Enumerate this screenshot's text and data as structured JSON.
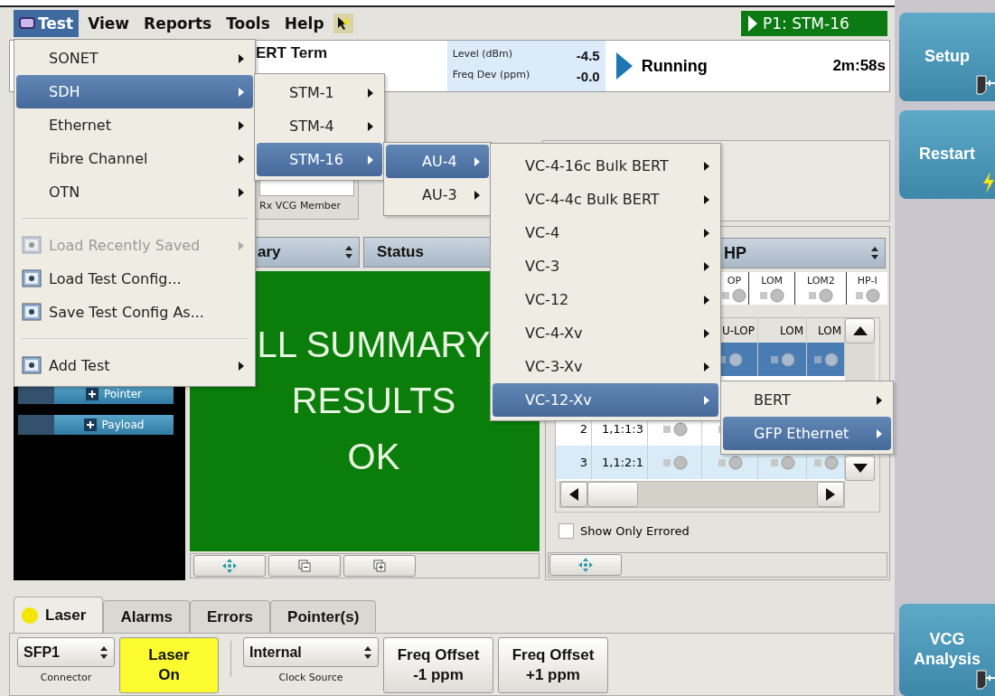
{
  "menubar": {
    "items": [
      {
        "label": "Test",
        "selected": true
      },
      {
        "label": "View",
        "selected": false
      },
      {
        "label": "Reports",
        "selected": false
      },
      {
        "label": "Tools",
        "selected": false
      },
      {
        "label": "Help",
        "selected": false
      }
    ],
    "port": "P1: STM-16"
  },
  "header": {
    "title": "ERT Term",
    "level_label": "Level (dBm)",
    "level_value": "-4.5",
    "freq_label": "Freq Dev (ppm)",
    "freq_value": "-0.0",
    "status": "Running",
    "elapsed": "2m:58s"
  },
  "vcg": {
    "label": "Rx VCG Member"
  },
  "tree": {
    "items": [
      {
        "label": "Pointer"
      },
      {
        "label": "Payload"
      }
    ]
  },
  "summary": {
    "columns": [
      {
        "label": "ary"
      },
      {
        "label": "Status"
      }
    ],
    "lines": [
      "LL SUMMARY",
      "RESULTS",
      "OK"
    ]
  },
  "alarms": {
    "layer": "HP",
    "indicators": [
      "OP",
      "LOM",
      "LOM2",
      "HP-I"
    ],
    "columns": [
      "U-LOP",
      "LOM",
      "LOM"
    ],
    "rows": [
      {
        "selected": true
      },
      {
        "index": "2",
        "channel": "1,1:1:3",
        "selected": false
      },
      {
        "index": "3",
        "channel": "1,1:2:1",
        "selected": false
      }
    ],
    "show_only_errored": {
      "label": "Show Only Errored",
      "checked": false
    }
  },
  "tabs": [
    {
      "label": "Laser",
      "selected": true,
      "color": "#f5e600"
    },
    {
      "label": "Alarms",
      "selected": false
    },
    {
      "label": "Errors",
      "selected": false
    },
    {
      "label": "Pointer(s)",
      "selected": false
    }
  ],
  "toolbar": {
    "connector": {
      "value": "SFP1",
      "label": "Connector"
    },
    "laser": {
      "label": "Laser On",
      "on": true
    },
    "clock": {
      "value": "Internal",
      "label": "Clock Source"
    },
    "buttons": [
      {
        "label": "Freq Offset -1 ppm"
      },
      {
        "label": "Freq Offset +1 ppm"
      }
    ]
  },
  "sidebar": {
    "top": [
      {
        "label": "Setup",
        "kind": "plug"
      },
      {
        "label": "Restart",
        "kind": "bolt"
      }
    ],
    "bottom": [
      {
        "label": "VCG Analysis",
        "kind": "plug"
      }
    ]
  },
  "menus": [
    {
      "items": [
        {
          "kind": "submenu",
          "label": "SONET",
          "selected": false,
          "disabled": false,
          "icon": false
        },
        {
          "kind": "submenu",
          "label": "SDH",
          "selected": true,
          "disabled": false,
          "icon": false
        },
        {
          "kind": "submenu",
          "label": "Ethernet",
          "selected": false,
          "disabled": false,
          "icon": false
        },
        {
          "kind": "submenu",
          "label": "Fibre Channel",
          "selected": false,
          "disabled": false,
          "icon": false
        },
        {
          "kind": "submenu",
          "label": "OTN",
          "selected": false,
          "disabled": false,
          "icon": false
        },
        {
          "kind": "separator"
        },
        {
          "kind": "submenu",
          "label": "Load Recently Saved",
          "selected": false,
          "disabled": true,
          "icon": true
        },
        {
          "kind": "action",
          "label": "Load Test Config...",
          "selected": false,
          "disabled": false,
          "icon": true
        },
        {
          "kind": "action",
          "label": "Save Test Config As...",
          "selected": false,
          "disabled": false,
          "icon": true
        },
        {
          "kind": "separator"
        },
        {
          "kind": "submenu",
          "label": "Add Test",
          "selected": false,
          "disabled": false,
          "icon": true
        }
      ]
    },
    {
      "items": [
        {
          "kind": "submenu",
          "label": "STM-1",
          "selected": false,
          "disabled": false,
          "icon": false
        },
        {
          "kind": "submenu",
          "label": "STM-4",
          "selected": false,
          "disabled": false,
          "icon": false
        },
        {
          "kind": "submenu",
          "label": "STM-16",
          "selected": true,
          "disabled": false,
          "icon": false
        }
      ]
    },
    {
      "items": [
        {
          "kind": "submenu",
          "label": "AU-4",
          "selected": true,
          "disabled": false,
          "icon": false
        },
        {
          "kind": "submenu",
          "label": "AU-3",
          "selected": false,
          "disabled": false,
          "icon": false
        }
      ]
    },
    {
      "items": [
        {
          "kind": "submenu",
          "label": "VC-4-16c Bulk BERT",
          "selected": false,
          "disabled": false,
          "icon": false
        },
        {
          "kind": "submenu",
          "label": "VC-4-4c Bulk BERT",
          "selected": false,
          "disabled": false,
          "icon": false
        },
        {
          "kind": "submenu",
          "label": "VC-4",
          "selected": false,
          "disabled": false,
          "icon": false
        },
        {
          "kind": "submenu",
          "label": "VC-3",
          "selected": false,
          "disabled": false,
          "icon": false
        },
        {
          "kind": "submenu",
          "label": "VC-12",
          "selected": false,
          "disabled": false,
          "icon": false
        },
        {
          "kind": "submenu",
          "label": "VC-4-Xv",
          "selected": false,
          "disabled": false,
          "icon": false
        },
        {
          "kind": "submenu",
          "label": "VC-3-Xv",
          "selected": false,
          "disabled": false,
          "icon": false
        },
        {
          "kind": "submenu",
          "label": "VC-12-Xv",
          "selected": true,
          "disabled": false,
          "icon": false
        }
      ]
    },
    {
      "items": [
        {
          "kind": "submenu",
          "label": "BERT",
          "selected": false,
          "disabled": false,
          "icon": false
        },
        {
          "kind": "submenu",
          "label": "GFP Ethernet",
          "selected": true,
          "disabled": false,
          "icon": false
        }
      ]
    }
  ]
}
